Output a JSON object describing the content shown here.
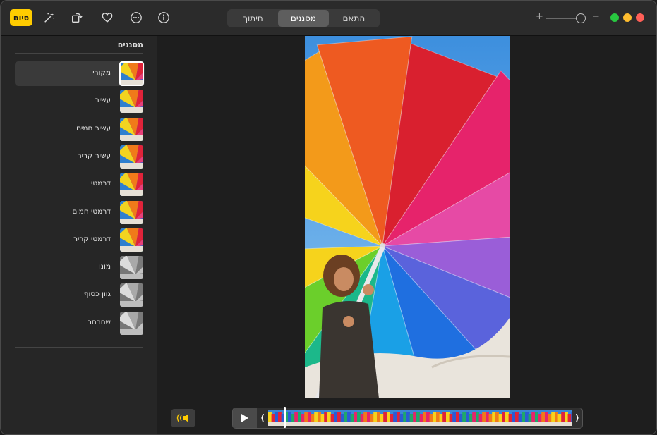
{
  "toolbar": {
    "done_label": "סיום",
    "icons": [
      "magic-wand-icon",
      "rotate-icon",
      "heart-icon",
      "more-icon",
      "info-icon"
    ],
    "tabs": [
      {
        "label": "התאם",
        "active": false
      },
      {
        "label": "מסננים",
        "active": true
      },
      {
        "label": "חיתוך",
        "active": false
      }
    ],
    "zoom": {
      "plus": "+",
      "minus": "−",
      "level": 0.15
    },
    "traffic_colors": {
      "close": "#ff5f57",
      "minimize": "#febc2e",
      "zoom": "#28c840"
    }
  },
  "sidebar": {
    "title": "מסננים",
    "filters": [
      {
        "label": "מקורי",
        "selected": true,
        "mono": false
      },
      {
        "label": "עשיר",
        "selected": false,
        "mono": false
      },
      {
        "label": "עשיר חמים",
        "selected": false,
        "mono": false
      },
      {
        "label": "עשיר קריר",
        "selected": false,
        "mono": false
      },
      {
        "label": "דרמטי",
        "selected": false,
        "mono": false
      },
      {
        "label": "דרמטי חמים",
        "selected": false,
        "mono": false
      },
      {
        "label": "דרמטי קריר",
        "selected": false,
        "mono": false
      },
      {
        "label": "מונו",
        "selected": false,
        "mono": true
      },
      {
        "label": "גוון כסוף",
        "selected": false,
        "mono": true
      },
      {
        "label": "שחרחר",
        "selected": false,
        "mono": true
      }
    ]
  },
  "player": {
    "audio_icon": "speaker-icon",
    "play_icon": "play-icon",
    "playhead_position": 0.05
  },
  "colors": {
    "accent": "#ffcc00",
    "sky": "#4fa3e8"
  }
}
